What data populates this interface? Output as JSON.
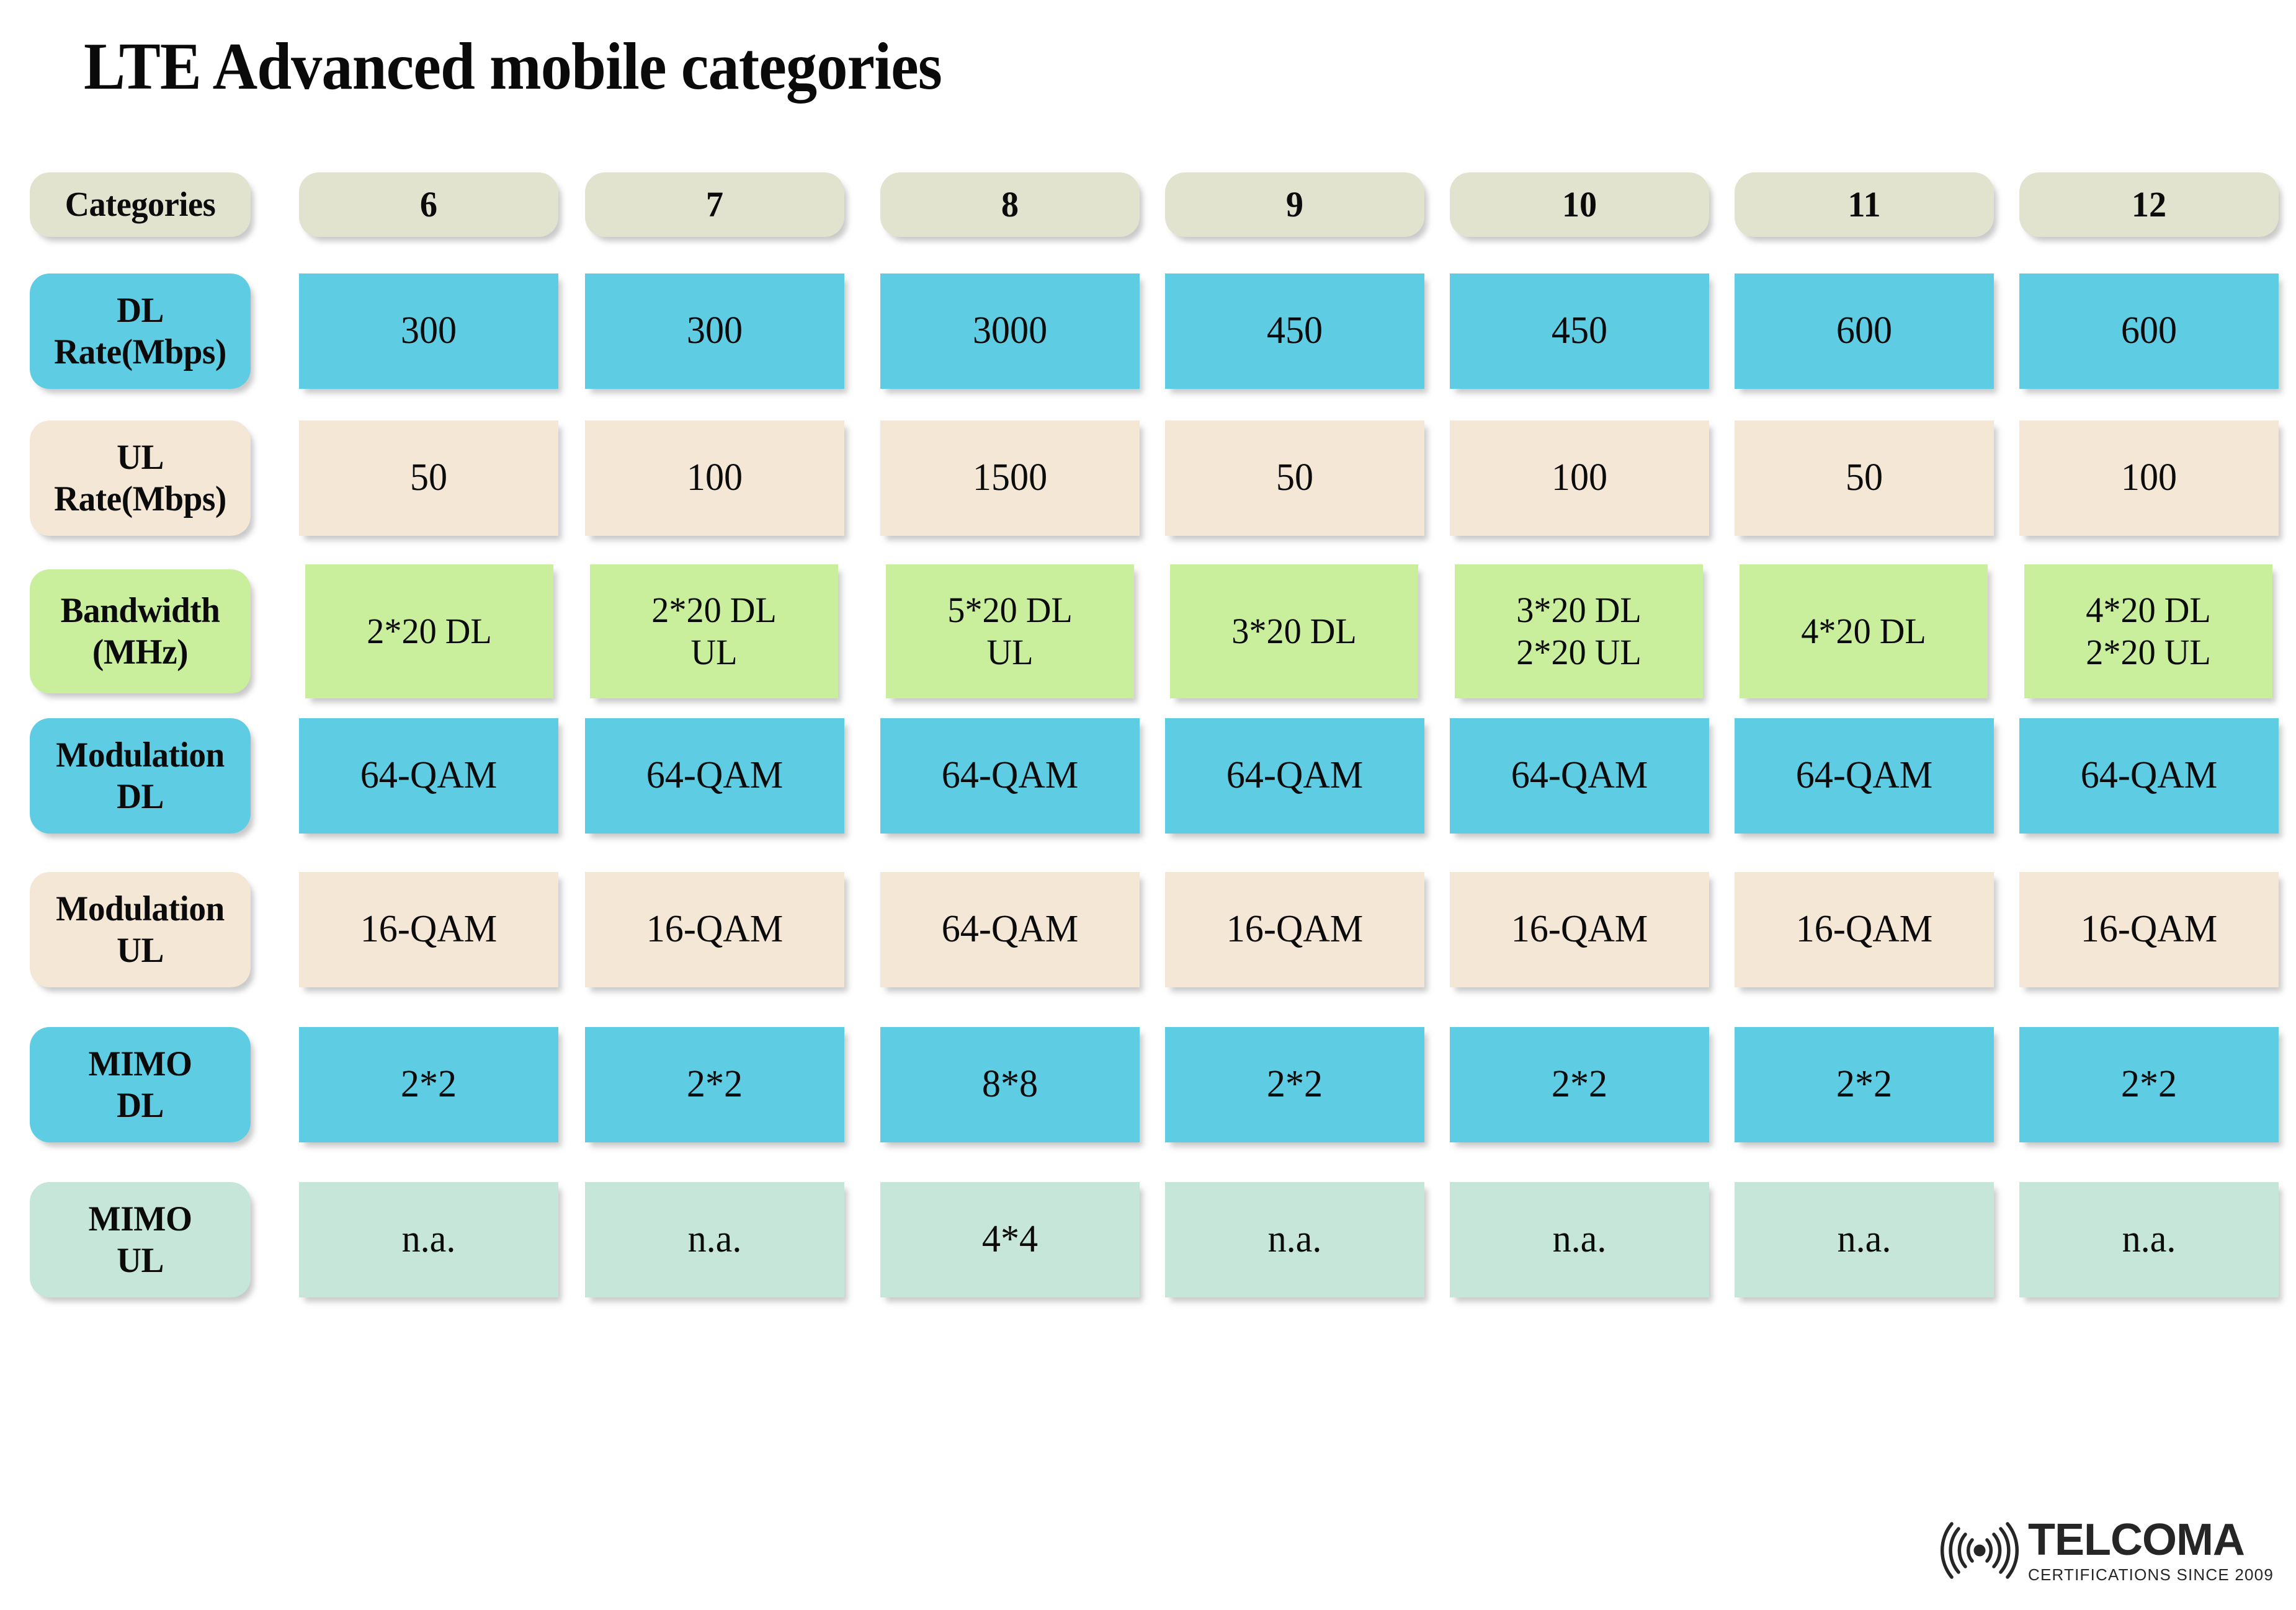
{
  "title": "LTE Advanced mobile categories",
  "colors": {
    "header": "#e1e3cf",
    "cyan": "#5ecde3",
    "cream": "#f4e7d6",
    "green": "#c9ef9c",
    "mint": "#c6e6d9",
    "text": "#0b0b0b",
    "background": "#ffffff"
  },
  "table": {
    "corner_label": "Categories",
    "columns": [
      "6",
      "7",
      "8",
      "9",
      "10",
      "11",
      "12"
    ],
    "rows": [
      {
        "label": "Categories",
        "color_key": "header",
        "values": [
          "6",
          "7",
          "8",
          "9",
          "10",
          "11",
          "12"
        ]
      },
      {
        "label": "DL\nRate(Mbps)",
        "color_key": "cyan",
        "values": [
          "300",
          "300",
          "3000",
          "450",
          "450",
          "600",
          "600"
        ]
      },
      {
        "label": "UL\nRate(Mbps)",
        "color_key": "cream",
        "values": [
          "50",
          "100",
          "1500",
          "50",
          "100",
          "50",
          "100"
        ]
      },
      {
        "label": "Bandwidth\n(MHz)",
        "color_key": "green",
        "values": [
          "2*20 DL",
          "2*20 DL\nUL",
          "5*20 DL\nUL",
          "3*20 DL",
          "3*20 DL\n2*20 UL",
          "4*20 DL",
          "4*20 DL\n2*20 UL"
        ]
      },
      {
        "label": "Modulation\nDL",
        "color_key": "cyan",
        "values": [
          "64-QAM",
          "64-QAM",
          "64-QAM",
          "64-QAM",
          "64-QAM",
          "64-QAM",
          "64-QAM"
        ]
      },
      {
        "label": "Modulation\nUL",
        "color_key": "cream",
        "values": [
          "16-QAM",
          "16-QAM",
          "64-QAM",
          "16-QAM",
          "16-QAM",
          "16-QAM",
          "16-QAM"
        ]
      },
      {
        "label": "MIMO\nDL",
        "color_key": "cyan",
        "values": [
          "2*2",
          "2*2",
          "8*8",
          "2*2",
          "2*2",
          "2*2",
          "2*2"
        ]
      },
      {
        "label": "MIMO\nUL",
        "color_key": "mint",
        "values": [
          "n.a.",
          "n.a.",
          "4*4",
          "n.a.",
          "n.a.",
          "n.a.",
          "n.a."
        ]
      }
    ]
  },
  "logo": {
    "icon": "wireless-signal-icon",
    "name": "TELCOMA",
    "tagline": "CERTIFICATIONS SINCE 2009"
  }
}
